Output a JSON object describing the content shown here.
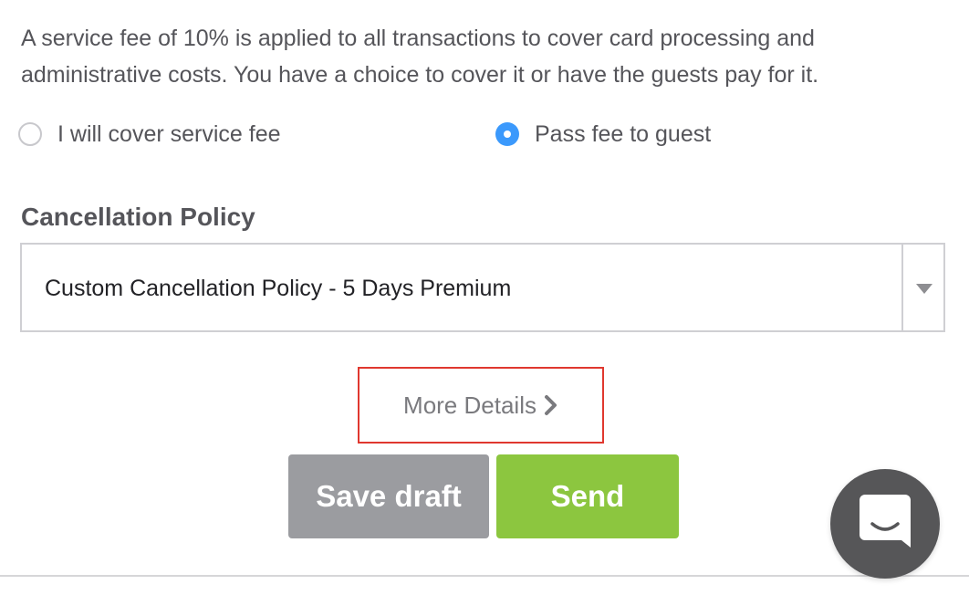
{
  "fee_notice": {
    "text": "A service fee of 10% is applied to all transactions to cover card processing and administrative costs. You have a choice to cover it or have the guests pay for it."
  },
  "fee_options": {
    "cover_label": "I will cover service fee",
    "cover_selected": false,
    "pass_label": "Pass fee to guest",
    "pass_selected": true
  },
  "cancellation": {
    "title": "Cancellation Policy",
    "selected_value": "Custom Cancellation Policy - 5 Days Premium",
    "arrow_icon": "triangle-down-icon"
  },
  "more_details": {
    "label": "More Details",
    "icon": "chevron-right-icon"
  },
  "actions": {
    "save_label": "Save draft",
    "send_label": "Send"
  },
  "chat": {
    "icon": "chat-bubble-icon"
  },
  "colors": {
    "radio_selected": "#3b99fc",
    "send_button": "#8cc63f",
    "save_button": "#9b9ca0",
    "highlight_border": "#e0382f",
    "chat_launcher": "#565658"
  }
}
